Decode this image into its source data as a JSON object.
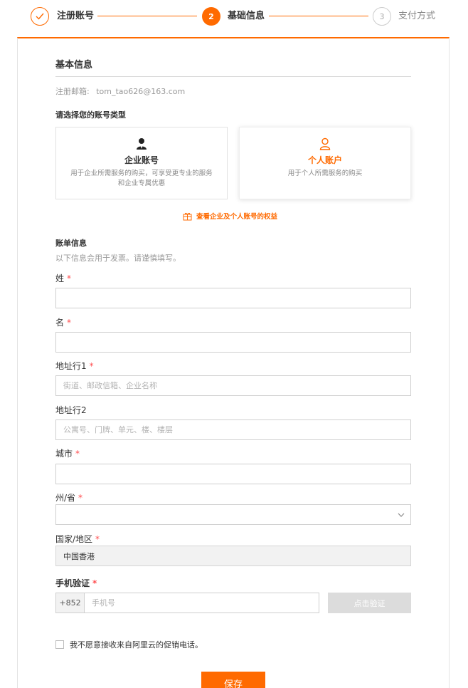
{
  "steps": [
    {
      "number": "✓",
      "label": "注册账号"
    },
    {
      "number": "2",
      "label": "基础信息"
    },
    {
      "number": "3",
      "label": "支付方式"
    }
  ],
  "basic": {
    "title": "基本信息",
    "email_label": "注册邮箱:",
    "email_value": "tom_tao626@163.com",
    "account_type_title": "请选择您的账号类型"
  },
  "account_types": [
    {
      "title": "企业账号",
      "desc": "用于企业所需服务的购买，可享受更专业的服务和企业专属优惠",
      "selected": false
    },
    {
      "title": "个人账户",
      "desc": "用于个人所需服务的购买",
      "selected": true
    }
  ],
  "rights_link": "查看企业及个人账号的权益",
  "billing": {
    "title": "账单信息",
    "subtitle": "以下信息会用于发票。请谨慎填写。"
  },
  "fields": {
    "last_name": {
      "label": "姓",
      "placeholder": "",
      "value": ""
    },
    "first_name": {
      "label": "名",
      "placeholder": "",
      "value": ""
    },
    "address1": {
      "label": "地址行1",
      "placeholder": "街道、邮政信箱、企业名称"
    },
    "address2": {
      "label": "地址行2",
      "placeholder": "公寓号、门牌、单元、楼、楼层"
    },
    "city": {
      "label": "城市",
      "placeholder": ""
    },
    "state": {
      "label": "州/省",
      "value": ""
    },
    "country": {
      "label": "国家/地区",
      "value": "中国香港"
    }
  },
  "phone": {
    "label": "手机验证",
    "prefix": "+852",
    "placeholder": "手机号",
    "verify_label": "点击验证"
  },
  "opt_out_label": "我不愿意接收来自阿里云的促销电话。",
  "save_label": "保存",
  "required_mark": "*",
  "colors": {
    "accent": "#ff6a00",
    "required": "#ff4d4f",
    "disabled": "#dcdcdc"
  }
}
